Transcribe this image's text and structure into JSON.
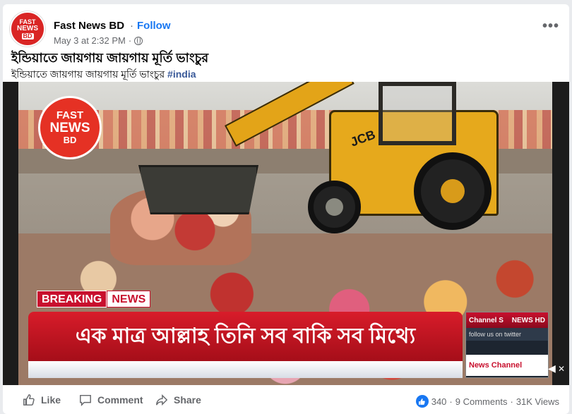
{
  "post": {
    "page_name": "Fast News BD",
    "separator": "·",
    "follow_label": "Follow",
    "timestamp": "May 3 at 2:32 PM",
    "meta_separator": "·",
    "privacy_icon": "globe-icon",
    "more_label": "•••",
    "title": "ইন্ডিয়াতে জায়গায় জায়গায় মূর্তি ভাংচুর",
    "caption_text": "ইন্ডিয়াতে জায়গায় জায়গায় মূর্তি ভাংচুর ",
    "caption_hashtag": "#india"
  },
  "avatar": {
    "line1": "FAST",
    "line2": "NEWS",
    "line3": "BD"
  },
  "video": {
    "logo_line1": "FAST",
    "logo_line2": "NEWS",
    "logo_line3": "BD",
    "jcb_label": "JCB",
    "breaking_label": "BREAKING",
    "news_label": "NEWS",
    "ticker_text": "এক মাত্র আল্লাহ তিনি সব বাকি সব মিথ্যে",
    "side_channel": "Channel S",
    "side_hd": "NEWS HD",
    "side_twitter": "follow us on twitter",
    "side_bottom": "News Channel"
  },
  "actions": {
    "like_label": "Like",
    "comment_label": "Comment",
    "share_label": "Share"
  },
  "stats": {
    "reactions_count": "340",
    "dot": "·",
    "comments": "9 Comments",
    "views": "31K Views"
  },
  "colors": {
    "accent": "#1877f2",
    "brand_red": "#d81c2a",
    "jcb_yellow": "#e3a418"
  }
}
